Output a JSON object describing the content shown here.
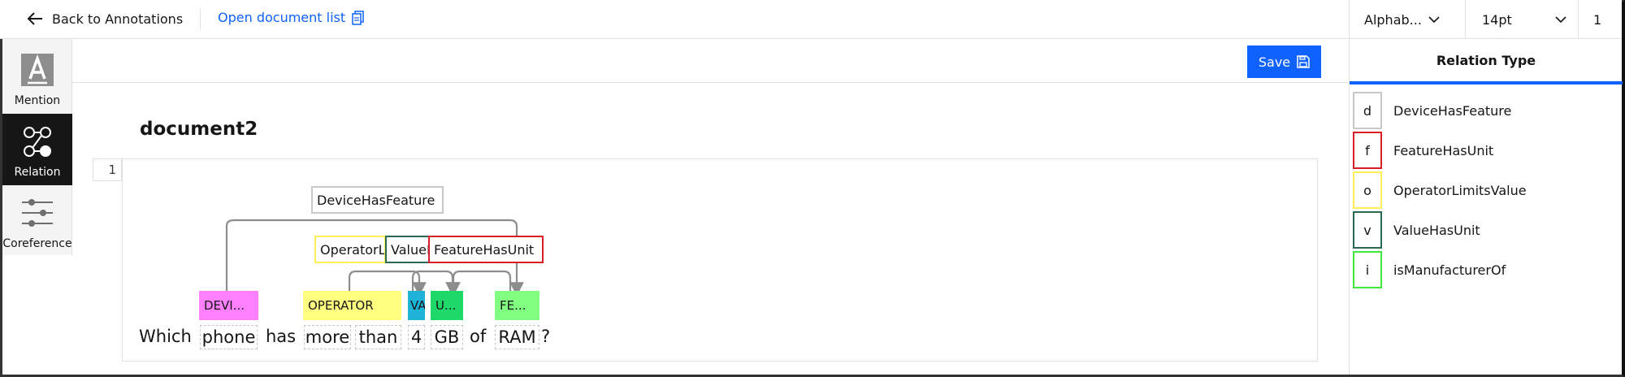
{
  "topbar": {
    "back_label": "Back to Annotations",
    "open_list_label": "Open document list",
    "sort_select": "Alphab...",
    "font_size_select": "14pt",
    "line_number": "1"
  },
  "tools": [
    {
      "label": "Mention",
      "icon": "mention-icon"
    },
    {
      "label": "Relation",
      "icon": "relation-icon",
      "active": true
    },
    {
      "label": "Coreference",
      "icon": "coreference-icon"
    }
  ],
  "save_label": "Save",
  "document": {
    "title": "document2",
    "line_number": "1",
    "tokens": [
      "Which",
      "phone",
      "has",
      "more",
      "than",
      "4",
      "GB",
      "of",
      "RAM",
      "?"
    ],
    "mentions": [
      {
        "label": "DEVI...",
        "color": "#ff80ff"
      },
      {
        "label": "OPERATOR",
        "color": "#ffff80"
      },
      {
        "label": "VA",
        "color": "#1fb3d8"
      },
      {
        "label": "U...",
        "color": "#1fd86a"
      },
      {
        "label": "FE...",
        "color": "#80ff80"
      }
    ],
    "relations": [
      {
        "label": "DeviceHasFeature",
        "color": "#c8c8c8"
      },
      {
        "label": "OperatorLimitsValue",
        "color": "#ffee55"
      },
      {
        "label": "ValueHasUnit",
        "color": "#2a6a52"
      },
      {
        "label": "FeatureHasUnit",
        "color": "#da1e28"
      }
    ]
  },
  "relation_panel": {
    "title": "Relation Type",
    "items": [
      {
        "key": "d",
        "name": "DeviceHasFeature",
        "color": "#c8c8c8"
      },
      {
        "key": "f",
        "name": "FeatureHasUnit",
        "color": "#da1e28"
      },
      {
        "key": "o",
        "name": "OperatorLimitsValue",
        "color": "#ffee55"
      },
      {
        "key": "v",
        "name": "ValueHasUnit",
        "color": "#2a6a52"
      },
      {
        "key": "i",
        "name": "isManufacturerOf",
        "color": "#42e842"
      }
    ]
  }
}
